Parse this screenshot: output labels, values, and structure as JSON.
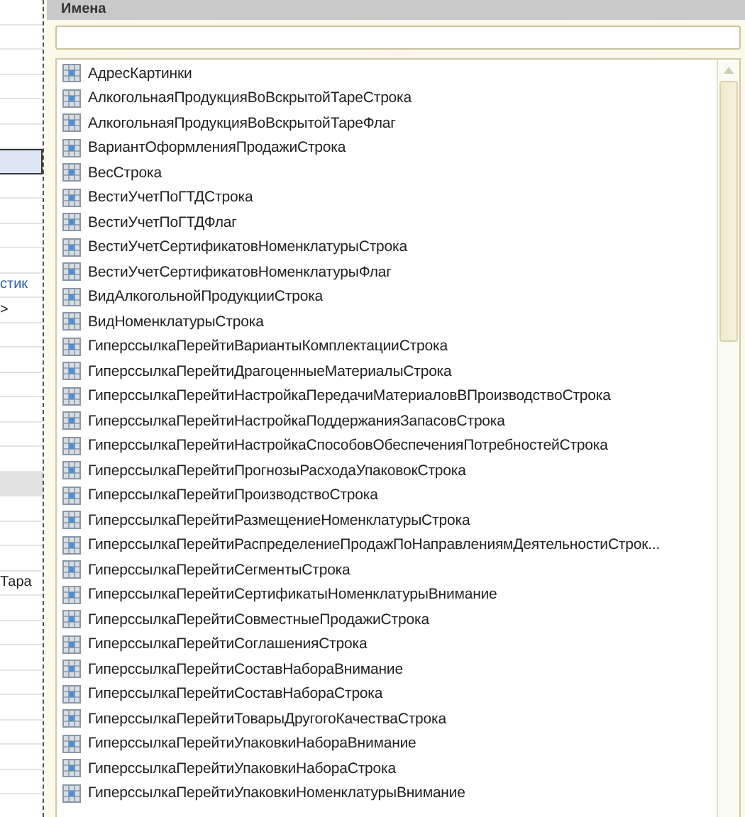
{
  "background_form": {
    "rows": [
      {
        "kind": "plain"
      },
      {
        "kind": "plain"
      },
      {
        "kind": "plain"
      },
      {
        "kind": "plain"
      },
      {
        "kind": "plain"
      },
      {
        "kind": "plain"
      },
      {
        "kind": "selected"
      },
      {
        "kind": "plain"
      },
      {
        "kind": "plain"
      },
      {
        "kind": "plain"
      },
      {
        "kind": "plain"
      },
      {
        "kind": "link",
        "text": "стик"
      },
      {
        "kind": "plain",
        "text": ">"
      },
      {
        "kind": "plain"
      },
      {
        "kind": "plain"
      },
      {
        "kind": "plain"
      },
      {
        "kind": "plain"
      },
      {
        "kind": "plain"
      },
      {
        "kind": "plain"
      },
      {
        "kind": "shaded"
      },
      {
        "kind": "plain"
      },
      {
        "kind": "plain"
      },
      {
        "kind": "plain"
      },
      {
        "kind": "plain",
        "text": "Тара"
      },
      {
        "kind": "plain"
      },
      {
        "kind": "plain"
      },
      {
        "kind": "plain"
      },
      {
        "kind": "plain"
      },
      {
        "kind": "plain"
      },
      {
        "kind": "plain"
      },
      {
        "kind": "plain"
      },
      {
        "kind": "plain"
      }
    ]
  },
  "panel": {
    "title": "Имена",
    "search": {
      "kind": "empty"
    },
    "items": [
      "АдресКартинки",
      "АлкогольнаяПродукцияВоВскрытойТареСтрока",
      "АлкогольнаяПродукцияВоВскрытойТареФлаг",
      "ВариантОформленияПродажиСтрока",
      "ВесСтрока",
      "ВестиУчетПоГТДСтрока",
      "ВестиУчетПоГТДФлаг",
      "ВестиУчетСертификатовНоменклатурыСтрока",
      "ВестиУчетСертификатовНоменклатурыФлаг",
      "ВидАлкогольнойПродукцииСтрока",
      "ВидНоменклатурыСтрока",
      "ГиперссылкаПерейтиВариантыКомплектацииСтрока",
      "ГиперссылкаПерейтиДрагоценныеМатериалыСтрока",
      "ГиперссылкаПерейтиНастройкаПередачиМатериаловВПроизводствоСтрока",
      "ГиперссылкаПерейтиНастройкаПоддержанияЗапасовСтрока",
      "ГиперссылкаПерейтиНастройкаСпособовОбеспеченияПотребностейСтрока",
      "ГиперссылкаПерейтиПрогнозыРасходаУпаковокСтрока",
      "ГиперссылкаПерейтиПроизводствоСтрока",
      "ГиперссылкаПерейтиРазмещениеНоменклатурыСтрока",
      "ГиперссылкаПерейтиРаспределениеПродажПоНаправлениямДеятельностиСтрок...",
      "ГиперссылкаПерейтиСегментыСтрока",
      "ГиперссылкаПерейтиСертификатыНоменклатурыВнимание",
      "ГиперссылкаПерейтиСовместныеПродажиСтрока",
      "ГиперссылкаПерейтиСоглашенияСтрока",
      "ГиперссылкаПерейтиСоставНабораВнимание",
      "ГиперссылкаПерейтиСоставНабораСтрока",
      "ГиперссылкаПерейтиТоварыДругогоКачестваСтрока",
      "ГиперссылкаПерейтиУпаковкиНабораВнимание",
      "ГиперссылкаПерейтиУпаковкиНабораСтрока",
      "ГиперссылкаПерейтиУпаковкиНоменклатурыВнимание"
    ]
  }
}
